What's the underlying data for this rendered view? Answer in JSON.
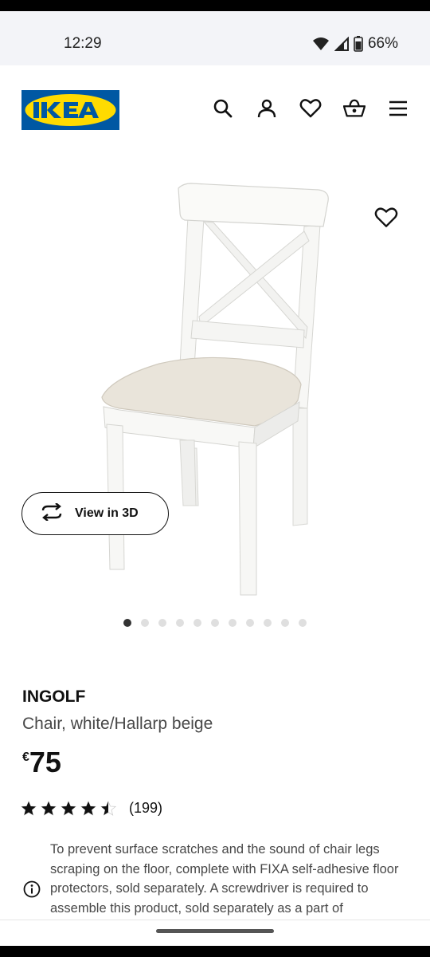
{
  "status_bar": {
    "time": "12:29",
    "battery": "66%"
  },
  "brand": {
    "logo_text": "IKEA",
    "colors": {
      "blue": "#0058a3",
      "yellow": "#ffdb00"
    }
  },
  "header": {
    "icons": [
      "search-icon",
      "account-icon",
      "wishlist-icon",
      "basket-icon",
      "menu-icon"
    ]
  },
  "product": {
    "name": "INGOLF",
    "description": "Chair, white/Hallarp beige",
    "price_currency": "€",
    "price_amount": "75",
    "rating": 4.5,
    "review_count": "(199)",
    "view_3d_label": "View in 3D",
    "gallery_count": 11,
    "gallery_active": 1,
    "info_text": "To prevent surface scratches and the sound of chair legs scraping on the floor, complete with FIXA self-adhesive floor protectors, sold separately. A screwdriver is required to assemble this product, sold separately as a part of"
  }
}
